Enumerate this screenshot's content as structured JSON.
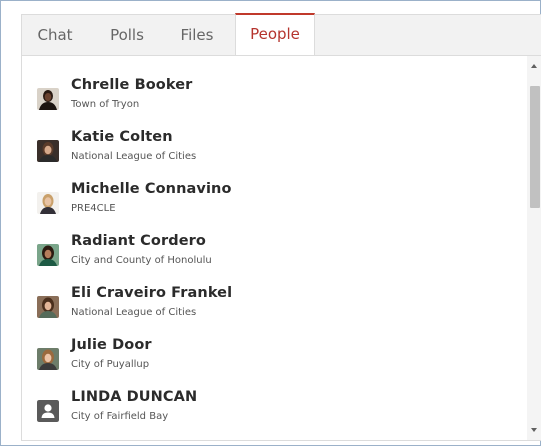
{
  "tabs": [
    {
      "label": "Chat"
    },
    {
      "label": "Polls"
    },
    {
      "label": "Files"
    },
    {
      "label": "People"
    }
  ],
  "active_tab": "People",
  "accent_color": "#c0392b",
  "people": [
    {
      "name": "Chrelle Booker",
      "org": "Town of Tryon",
      "avatar": "photo"
    },
    {
      "name": "Katie Colten",
      "org": "National League of Cities",
      "avatar": "photo"
    },
    {
      "name": "Michelle Connavino",
      "org": "PRE4CLE",
      "avatar": "photo"
    },
    {
      "name": "Radiant Cordero",
      "org": "City and County of Honolulu",
      "avatar": "photo"
    },
    {
      "name": "Eli Craveiro Frankel",
      "org": "National League of Cities",
      "avatar": "photo"
    },
    {
      "name": "Julie Door",
      "org": "City of Puyallup",
      "avatar": "photo"
    },
    {
      "name": "LINDA DUNCAN",
      "org": "City of Fairfield Bay",
      "avatar": "default-user-icon"
    }
  ]
}
